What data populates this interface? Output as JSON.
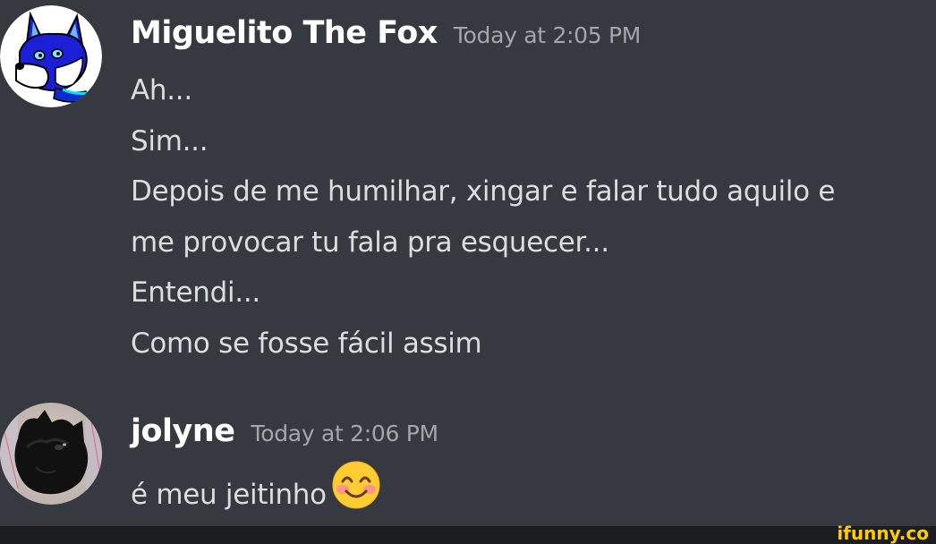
{
  "messages": [
    {
      "username": "Miguelito The Fox",
      "timestamp": "Today at 2:05 PM",
      "avatar": "blue-fox-avatar",
      "lines": [
        "Ah...",
        "Sim...",
        "Depois de me humilhar, xingar e falar tudo aquilo e",
        "me provocar tu fala pra esquecer...",
        "Entendi...",
        "Como se fosse fácil assim"
      ]
    },
    {
      "username": "jolyne",
      "timestamp": "Today at 2:06 PM",
      "avatar": "black-cat-avatar",
      "lines": [
        "é meu jeitinho"
      ],
      "emoji": "smiling-face-with-smiling-eyes-emoji"
    }
  ],
  "watermark": "ifunny.co",
  "colors": {
    "background": "#36393f",
    "username": "#ffffff",
    "timestamp": "#a3a6aa",
    "text": "#dcddde",
    "watermark": "#ffcc00"
  }
}
